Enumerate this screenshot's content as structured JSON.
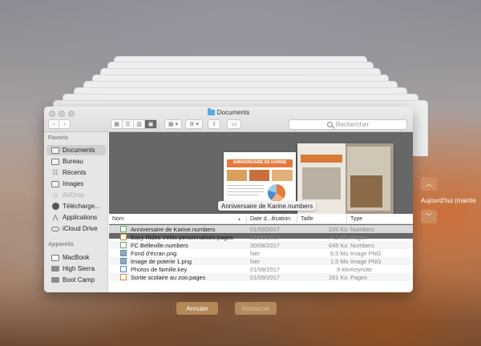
{
  "window": {
    "title": "Documents",
    "toolbar": {
      "back_icon": "chevron-left-icon",
      "forward_icon": "chevron-right-icon",
      "views": [
        "icons-view-icon",
        "list-view-icon",
        "columns-view-icon",
        "gallery-view-icon"
      ],
      "arrange_icon": "grid-arrange-icon",
      "action_icon": "gear-icon",
      "share_icon": "share-icon",
      "tag_icon": "tag-icon",
      "search_placeholder": "Rechercher"
    }
  },
  "sidebar": {
    "favorites_heading": "Favoris",
    "favorites": [
      {
        "label": "Documents",
        "icon": "documents-folder-icon",
        "selected": true
      },
      {
        "label": "Bureau",
        "icon": "desktop-folder-icon"
      },
      {
        "label": "Récents",
        "icon": "recents-icon"
      },
      {
        "label": "Images",
        "icon": "pictures-folder-icon"
      },
      {
        "label": "AirDrop",
        "icon": "airdrop-icon",
        "dim": true
      },
      {
        "label": "Télécharge...",
        "icon": "downloads-icon"
      },
      {
        "label": "Applications",
        "icon": "applications-icon"
      },
      {
        "label": "iCloud Drive",
        "icon": "icloud-icon"
      }
    ],
    "devices_heading": "Appareils",
    "devices": [
      {
        "label": "MacBook",
        "icon": "laptop-icon"
      },
      {
        "label": "High Sierra",
        "icon": "hard-disk-icon"
      },
      {
        "label": "Boot Camp",
        "icon": "hard-disk-icon"
      }
    ]
  },
  "preview": {
    "label": "Anniversaire de Karine.numbers",
    "doc_heading": "ANNIVERSAIRE DE KARINE"
  },
  "table": {
    "headers": {
      "name": "Nom",
      "date": "Date d...ification",
      "size": "Taille",
      "kind": "Type"
    },
    "rows": [
      {
        "name": "Anniversaire de Karine.numbers",
        "date": "01/09/2017",
        "size": "220 Ko",
        "kind": "Numbers",
        "icon": "numbers-file-icon",
        "selected": true
      },
      {
        "name": "Easy Rides Vélos personnalisés.pages",
        "date": "01/09/2017",
        "size": "4,3 Mo",
        "kind": "Pages",
        "icon": "pages-file-icon"
      },
      {
        "name": "FC Belleville.numbers",
        "date": "30/08/2017",
        "size": "645 Ko",
        "kind": "Numbers",
        "icon": "numbers-file-icon"
      },
      {
        "name": "Fond d'écran.png",
        "date": "hier",
        "size": "6,5 Mo",
        "kind": "Image PNG",
        "icon": "image-file-icon"
      },
      {
        "name": "Image de poterie 1.png",
        "date": "hier",
        "size": "1,5 Mo",
        "kind": "Image PNG",
        "icon": "image-file-icon"
      },
      {
        "name": "Photos de famille.key",
        "date": "01/09/2017",
        "size": "9 Mo",
        "kind": "Keynote",
        "icon": "keynote-file-icon"
      },
      {
        "name": "Sortie scolaire au zoo.pages",
        "date": "01/09/2017",
        "size": "281 Ko",
        "kind": "Pages",
        "icon": "pages-file-icon"
      }
    ]
  },
  "buttons": {
    "cancel": "Annuler",
    "restore": "Restaurer"
  },
  "timeline": {
    "up_icon": "chevron-up-icon",
    "down_icon": "chevron-down-icon",
    "label": "Aujourd'hui (mainte"
  }
}
